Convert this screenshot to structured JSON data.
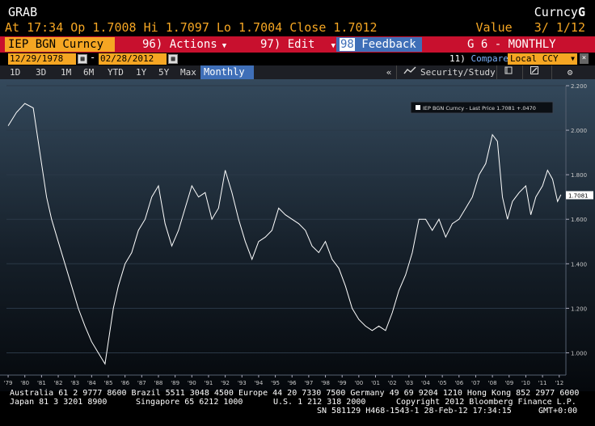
{
  "header": {
    "title": "GRAB",
    "right_label": "Curncy",
    "right_key": "G",
    "quote_time_label": "At",
    "quote_time": "17:34",
    "open_label": "Op",
    "open": "1.7008",
    "high_label": "Hi",
    "high": "1.7097",
    "low_label": "Lo",
    "low": "1.7004",
    "close_label": "Close",
    "close": "1.7012",
    "value_label": "Value",
    "value_page": "3/ 1/12"
  },
  "command_bar": {
    "ticker": "IEP BGN Curncy",
    "actions": "96) Actions",
    "edit": "97) Edit",
    "feedback_num": "98",
    "feedback": "Feedback",
    "chart_id": "G 6 - MONTHLY"
  },
  "date_row": {
    "start": "12/29/1978",
    "end": "02/28/2012",
    "compare_num": "11)",
    "compare": "Compare",
    "currency": "Local CCY"
  },
  "toolbar": {
    "periods": [
      "1D",
      "3D",
      "1M",
      "6M",
      "YTD",
      "1Y",
      "5Y",
      "Max"
    ],
    "frequency": "Monthly",
    "collapse": "«",
    "security_study": "Security/Study"
  },
  "chart_data": {
    "type": "line",
    "series": [
      {
        "name": "IEP BGN Curncy - Last Price",
        "last": "1.7081",
        "change": "+.0470"
      }
    ],
    "x": [
      1979,
      1979.5,
      1980,
      1980.5,
      1981,
      1981.3,
      1981.6,
      1982,
      1982.4,
      1982.8,
      1983.2,
      1983.6,
      1984,
      1984.4,
      1984.8,
      1985.0,
      1985.3,
      1985.6,
      1986,
      1986.4,
      1986.8,
      1987.2,
      1987.6,
      1988,
      1988.4,
      1988.8,
      1989.2,
      1989.6,
      1990,
      1990.4,
      1990.8,
      1991.2,
      1991.6,
      1992,
      1992.4,
      1992.8,
      1993.2,
      1993.6,
      1994,
      1994.4,
      1994.8,
      1995.2,
      1995.6,
      1996,
      1996.4,
      1996.8,
      1997.2,
      1997.6,
      1998,
      1998.4,
      1998.8,
      1999.2,
      1999.6,
      2000,
      2000.4,
      2000.8,
      2001.2,
      2001.6,
      2002,
      2002.4,
      2002.8,
      2003.2,
      2003.6,
      2004,
      2004.4,
      2004.8,
      2005.2,
      2005.6,
      2006,
      2006.4,
      2006.8,
      2007.2,
      2007.6,
      2008,
      2008.3,
      2008.6,
      2008.9,
      2009.2,
      2009.6,
      2010,
      2010.3,
      2010.6,
      2011,
      2011.3,
      2011.6,
      2011.9,
      2012.1
    ],
    "values": [
      2.02,
      2.08,
      2.12,
      2.1,
      1.85,
      1.7,
      1.6,
      1.5,
      1.4,
      1.3,
      1.2,
      1.12,
      1.05,
      1.0,
      0.95,
      1.05,
      1.2,
      1.3,
      1.4,
      1.45,
      1.55,
      1.6,
      1.7,
      1.75,
      1.58,
      1.48,
      1.55,
      1.65,
      1.75,
      1.7,
      1.72,
      1.6,
      1.65,
      1.82,
      1.72,
      1.6,
      1.5,
      1.42,
      1.5,
      1.52,
      1.55,
      1.65,
      1.62,
      1.6,
      1.58,
      1.55,
      1.48,
      1.45,
      1.5,
      1.42,
      1.38,
      1.3,
      1.2,
      1.15,
      1.12,
      1.1,
      1.12,
      1.1,
      1.18,
      1.28,
      1.35,
      1.45,
      1.6,
      1.6,
      1.55,
      1.6,
      1.52,
      1.58,
      1.6,
      1.65,
      1.7,
      1.8,
      1.85,
      1.98,
      1.95,
      1.7,
      1.6,
      1.68,
      1.72,
      1.75,
      1.62,
      1.7,
      1.75,
      1.82,
      1.78,
      1.68,
      1.71
    ],
    "y_ticks": [
      "1.000",
      "1.200",
      "1.400",
      "1.600",
      "1.800",
      "2.000",
      "2.200"
    ],
    "ylim": [
      0.9,
      2.2
    ],
    "x_ticks": [
      "'79",
      "'80",
      "'81",
      "'82",
      "'83",
      "'84",
      "'85",
      "'86",
      "'87",
      "'88",
      "'89",
      "'90",
      "'91",
      "'92",
      "'93",
      "'94",
      "'95",
      "'96",
      "'97",
      "'98",
      "'99",
      "'00",
      "'01",
      "'02",
      "'03",
      "'04",
      "'05",
      "'06",
      "'07",
      "'08",
      "'09",
      "'10",
      "'11",
      "'12"
    ],
    "xlim": [
      1978.9,
      2012.4
    ],
    "last_price_label": "1.7081",
    "grid": false,
    "legend_placement": "top-right"
  },
  "footer": {
    "line1": "Australia 61 2 9777 8600 Brazil 5511 3048 4500 Europe 44 20 7330 7500 Germany 49 69 9204 1210 Hong Kong 852 2977 6000",
    "line2a": "Japan 81 3 3201 8900",
    "line2b": "Singapore 65 6212 1000",
    "line2c": "U.S. 1 212 318 2000",
    "line2d": "Copyright 2012 Bloomberg Finance L.P.",
    "line3": "SN 581129 H468-1543-1 28-Feb-12 17:34:15",
    "line3b": "GMT+0:00"
  },
  "colors": {
    "accent": "#f5a623",
    "bar": "#c8102e",
    "blue": "#3f6fb8"
  }
}
